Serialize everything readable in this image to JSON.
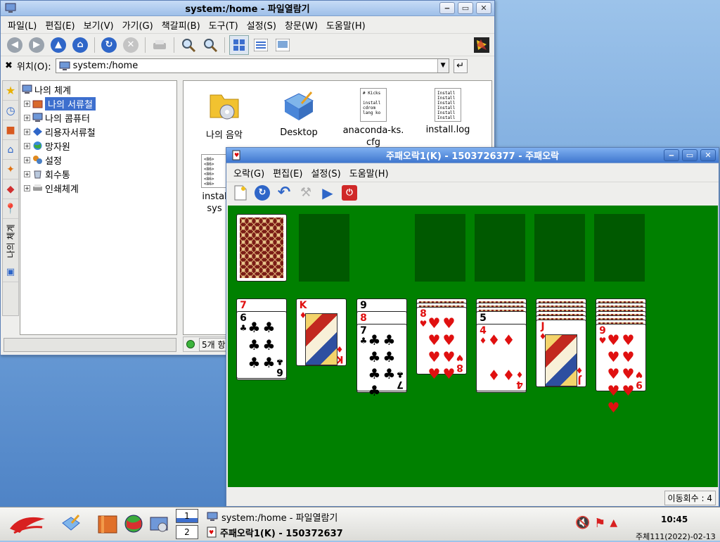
{
  "filemanager": {
    "title": "system:/home - 파일열람기",
    "menu": [
      "파일(L)",
      "편집(E)",
      "보기(V)",
      "가기(G)",
      "책갈피(B)",
      "도구(T)",
      "설정(S)",
      "창문(W)",
      "도움말(H)"
    ],
    "location_label": "위치(O):",
    "location_value": "system:/home",
    "sidebar_tab": "나의 체계",
    "tree": {
      "root": "나의 체계",
      "items": [
        "나의 서류철",
        "나의 콤퓨터",
        "리용자서류철",
        "망자원",
        "설정",
        "회수통",
        "인쇄체계"
      ]
    },
    "files": [
      {
        "name": "나의 음악"
      },
      {
        "name": "Desktop"
      },
      {
        "name": "anaconda-ks.\ncfg",
        "preview": "# Kicks\n\ninstall\ncdrom\nlang ko"
      },
      {
        "name": "install.log",
        "preview": "Install\nInstall\nInstall\nInstall\nInstall\nInstall"
      },
      {
        "name": "instal\nsys",
        "preview": "<86>\n<86>\n<86>\n<86>\n<86>\n<86>"
      }
    ],
    "status": "5개 항"
  },
  "solitaire": {
    "title": "주패오락1(K) - 1503726377 - 주패오락",
    "menu": [
      "오락(G)",
      "편집(E)",
      "설정(S)",
      "도움말(H)"
    ],
    "moves_label": "이동회수 : 4",
    "tableau": [
      {
        "hidden": 0,
        "cards": [
          {
            "rank": "7",
            "suit": "♦"
          },
          {
            "rank": "6",
            "suit": "♣"
          }
        ]
      },
      {
        "hidden": 0,
        "cards": [
          {
            "rank": "K",
            "suit": "♦"
          }
        ]
      },
      {
        "hidden": 0,
        "cards": [
          {
            "rank": "9",
            "suit": "♣"
          },
          {
            "rank": "8",
            "suit": "♦"
          },
          {
            "rank": "7",
            "suit": "♣"
          }
        ]
      },
      {
        "hidden": 2,
        "cards": [
          {
            "rank": "8",
            "suit": "♥"
          }
        ]
      },
      {
        "hidden": 3,
        "cards": [
          {
            "rank": "5",
            "suit": "♣"
          },
          {
            "rank": "4",
            "suit": "♦"
          }
        ]
      },
      {
        "hidden": 5,
        "cards": [
          {
            "rank": "J",
            "suit": "♦"
          }
        ]
      },
      {
        "hidden": 6,
        "cards": [
          {
            "rank": "9",
            "suit": "♥"
          }
        ]
      }
    ]
  },
  "taskbar": {
    "tasks": [
      "system:/home - 파일열람기",
      "주패오락1(K) - 150372637"
    ],
    "desktops": [
      "1",
      "2"
    ],
    "clock": "10:45",
    "date": "주체111(2022)-02-13"
  },
  "colors": {
    "felt": "#008000",
    "slot": "#005900",
    "selection": "#3d6fce",
    "title_active": "#3f77cf"
  }
}
